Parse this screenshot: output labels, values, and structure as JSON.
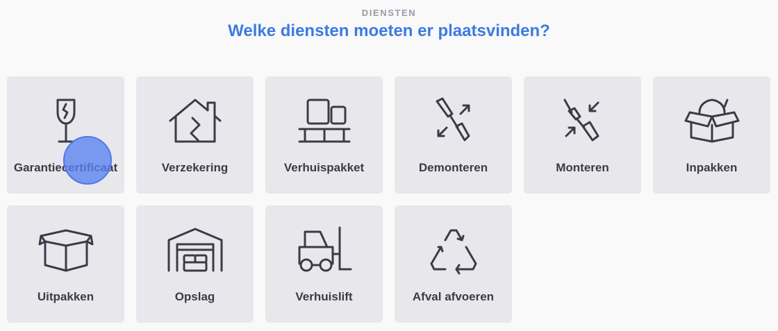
{
  "header": {
    "eyebrow": "DIENSTEN",
    "title": "Welke diensten moeten er plaatsvinden?"
  },
  "services": [
    {
      "label": "Garantiecertificaat",
      "icon": "fragile-glass-icon"
    },
    {
      "label": "Verzekering",
      "icon": "house-insurance-icon"
    },
    {
      "label": "Verhuispakket",
      "icon": "boxes-on-pallet-icon"
    },
    {
      "label": "Demonteren",
      "icon": "screwdriver-disassemble-icon"
    },
    {
      "label": "Monteren",
      "icon": "screwdriver-assemble-icon"
    },
    {
      "label": "Inpakken",
      "icon": "pack-box-icon"
    },
    {
      "label": "Uitpakken",
      "icon": "open-box-icon"
    },
    {
      "label": "Opslag",
      "icon": "storage-warehouse-icon"
    },
    {
      "label": "Verhuislift",
      "icon": "forklift-icon"
    },
    {
      "label": "Afval afvoeren",
      "icon": "recycle-icon"
    }
  ],
  "colors": {
    "accent": "#3b7be0",
    "card": "#e8e8ec",
    "text": "#3a3b47",
    "eyebrow": "#9a9ca5"
  }
}
